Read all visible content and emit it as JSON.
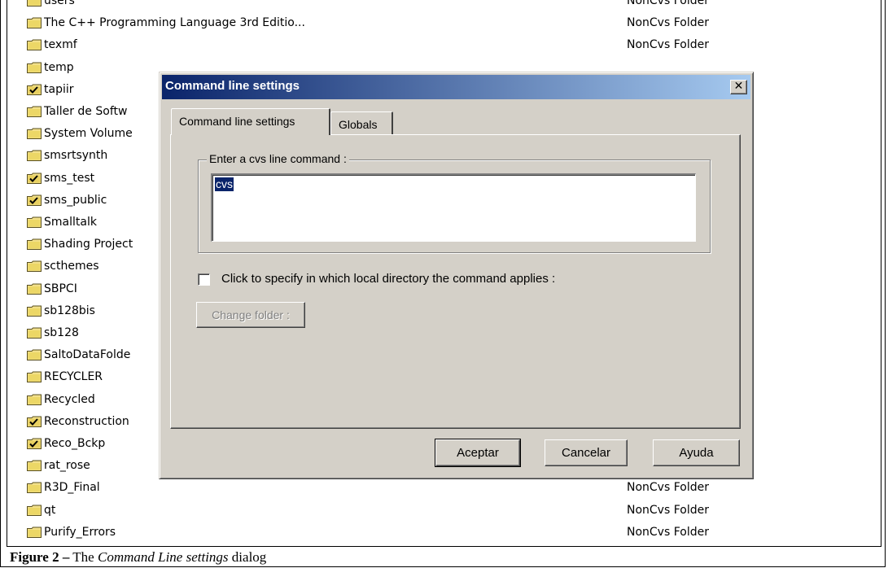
{
  "listing": {
    "rows": [
      {
        "name": "users",
        "type": "NonCvs Folder",
        "icon": "folder-icon"
      },
      {
        "name": "The C++ Programming Language 3rd Editio...",
        "type": "NonCvs Folder",
        "icon": "folder-icon"
      },
      {
        "name": "texmf",
        "type": "NonCvs Folder",
        "icon": "folder-icon"
      },
      {
        "name": "temp",
        "type": "",
        "icon": "folder-icon"
      },
      {
        "name": "tapiir",
        "type": "",
        "icon": "cvs-folder-icon"
      },
      {
        "name": "Taller de Softw",
        "type": "",
        "icon": "folder-icon"
      },
      {
        "name": "System Volume",
        "type": "",
        "icon": "folder-icon"
      },
      {
        "name": "smsrtsynth",
        "type": "",
        "icon": "folder-icon"
      },
      {
        "name": "sms_test",
        "type": "",
        "icon": "cvs-folder-icon"
      },
      {
        "name": "sms_public",
        "type": "",
        "icon": "cvs-folder-icon"
      },
      {
        "name": "Smalltalk",
        "type": "",
        "icon": "folder-icon"
      },
      {
        "name": "Shading Project",
        "type": "",
        "icon": "folder-icon"
      },
      {
        "name": "scthemes",
        "type": "",
        "icon": "folder-icon"
      },
      {
        "name": "SBPCI",
        "type": "",
        "icon": "folder-icon"
      },
      {
        "name": "sb128bis",
        "type": "",
        "icon": "folder-icon"
      },
      {
        "name": "sb128",
        "type": "",
        "icon": "folder-icon"
      },
      {
        "name": "SaltoDataFolde",
        "type": "",
        "icon": "folder-icon"
      },
      {
        "name": "RECYCLER",
        "type": "",
        "icon": "folder-icon"
      },
      {
        "name": "Recycled",
        "type": "",
        "icon": "folder-icon"
      },
      {
        "name": "Reconstruction",
        "type": "",
        "icon": "cvs-folder-icon"
      },
      {
        "name": "Reco_Bckp",
        "type": "",
        "icon": "cvs-folder-icon"
      },
      {
        "name": "rat_rose",
        "type": "",
        "icon": "folder-icon"
      },
      {
        "name": "R3D_Final",
        "type": "NonCvs Folder",
        "icon": "folder-icon"
      },
      {
        "name": "qt",
        "type": "NonCvs Folder",
        "icon": "folder-icon"
      },
      {
        "name": "Purify_Errors",
        "type": "NonCvs Folder",
        "icon": "folder-icon"
      }
    ]
  },
  "dialog": {
    "title": "Command line settings",
    "tabs": [
      "Command line settings",
      "Globals"
    ],
    "group_label": "Enter a cvs line command :",
    "command_value": "cvs",
    "checkbox_label": "Click to specify in which local directory the command applies :",
    "change_folder_label": "Change folder :",
    "buttons": {
      "ok": "Aceptar",
      "cancel": "Cancelar",
      "help": "Ayuda"
    },
    "close_glyph": "✕"
  },
  "caption": {
    "prefix": "Figure 2 –",
    "text_before": " The ",
    "italic": "Command Line settings",
    "text_after": " dialog"
  },
  "colors": {
    "titlebar_start": "#0a246a",
    "titlebar_end": "#a6caf0",
    "face": "#d4d0c8",
    "selection": "#0a246a"
  }
}
